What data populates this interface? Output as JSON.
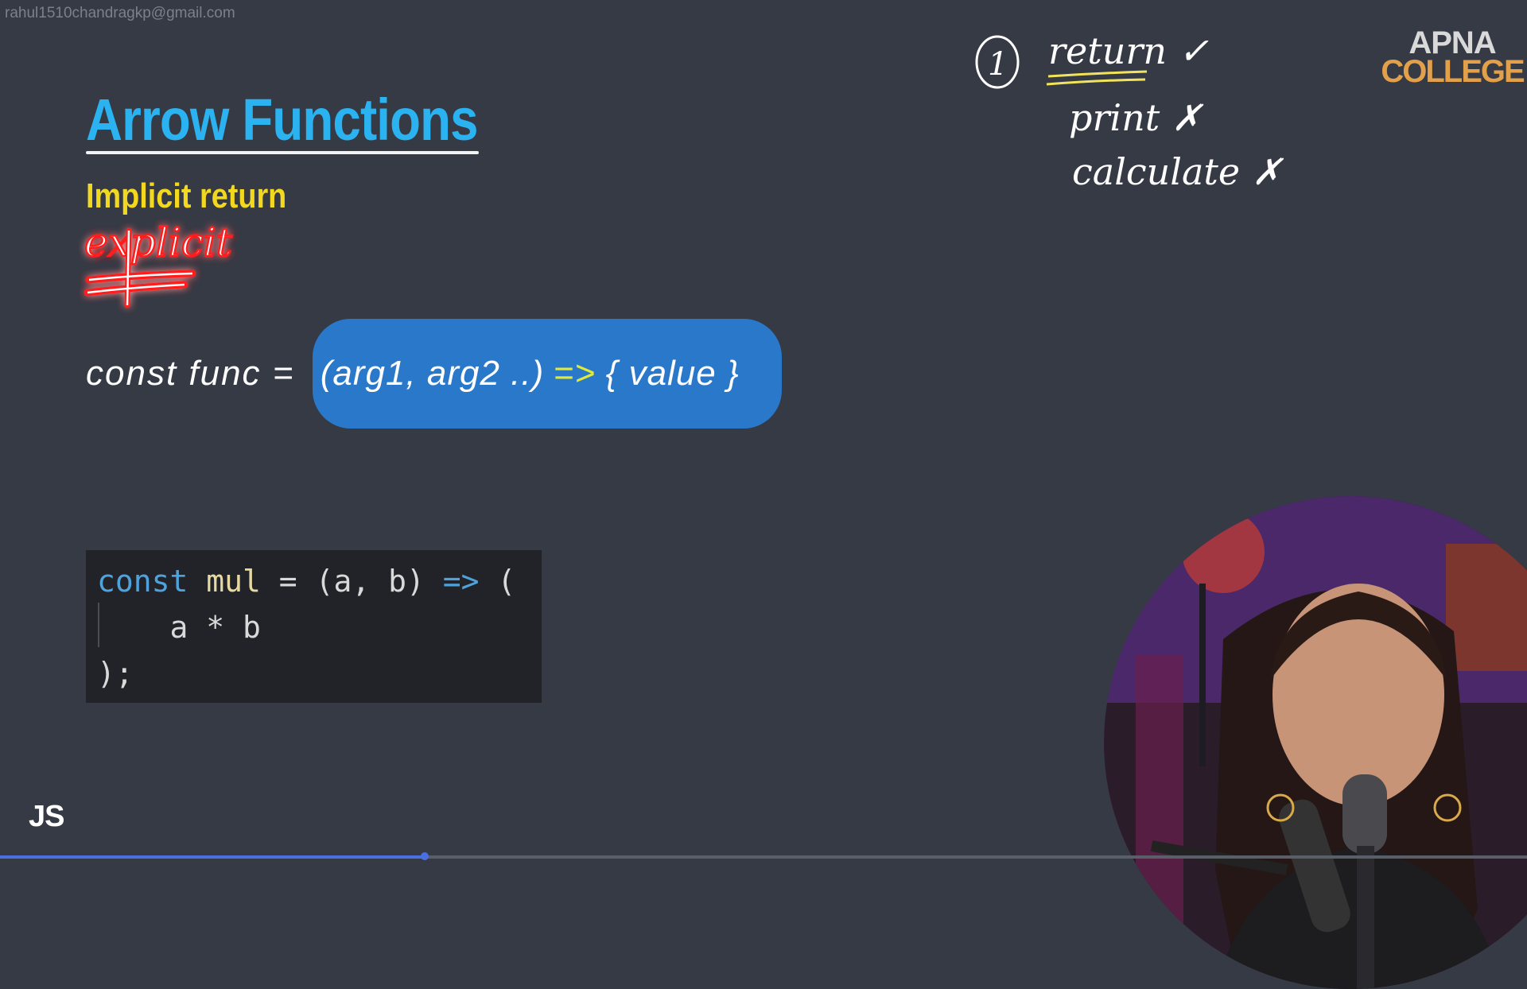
{
  "watermark": "rahul1510chandragkp@gmail.com",
  "slide": {
    "title": "Arrow Functions",
    "subtitle": "Implicit return",
    "syntax": {
      "prefix": "const func = ",
      "args": "(arg1, arg2 ..)",
      "arrow": "=>",
      "body": "{ value }"
    },
    "code": {
      "line1": {
        "kw": "const",
        "name": "mul",
        "eq": " = ",
        "params": "(a, b) ",
        "arrow": "=>",
        "open": " ("
      },
      "line2": "    a * b",
      "line3": ");"
    },
    "badge": "JS"
  },
  "logo": {
    "line1": "APNA",
    "line2": "COLLEGE",
    "line2_color": "#e3a04a"
  },
  "annotations": {
    "red_word": "explicit",
    "number": "1",
    "return": "return ✓",
    "print": "print ✗",
    "calculate": "calculate ✗"
  },
  "video": {
    "progress": 0.278,
    "progress_color": "#4a6fe3"
  },
  "colors": {
    "title": "#2ab3f0",
    "subtitle": "#f2d81f",
    "pill": "#2a78c9",
    "background": "#353a45"
  }
}
